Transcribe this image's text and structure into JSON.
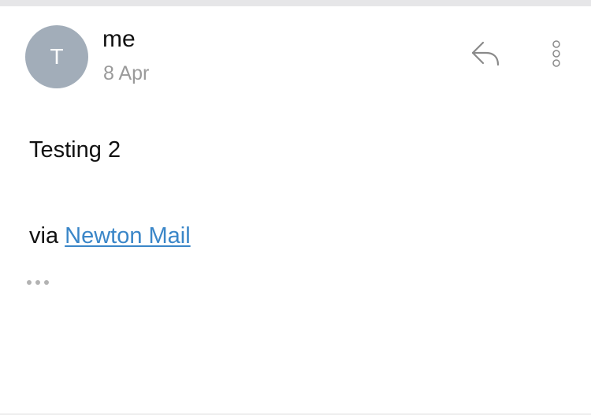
{
  "message": {
    "sender": {
      "avatar_initial": "T",
      "name": "me",
      "date": "8 Apr"
    },
    "body": {
      "text": "Testing 2",
      "signature_prefix": "via ",
      "signature_link": "Newton Mail"
    }
  },
  "icons": {
    "reply": "reply-arrow",
    "more": "vertical-ellipsis",
    "collapsed_content": "horizontal-ellipsis"
  },
  "colors": {
    "avatar_background": "#a2adb9",
    "link": "#3a86c8",
    "secondary_text": "#9a9a9a",
    "icon": "#8a8a8a"
  }
}
